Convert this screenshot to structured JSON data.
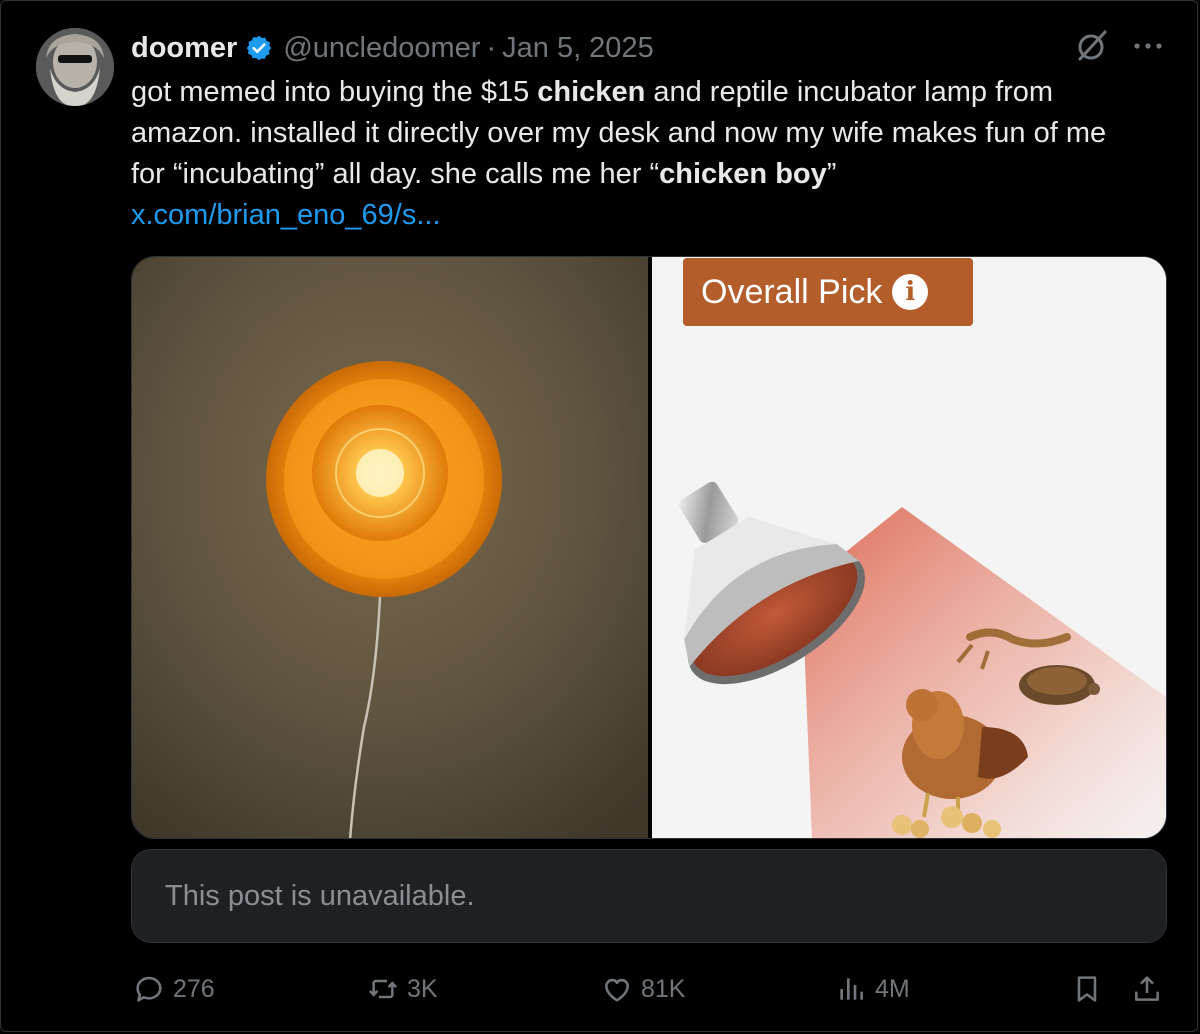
{
  "post": {
    "author_name": "doomer",
    "handle": "@uncledoomer",
    "separator": "·",
    "date": "Jan 5, 2025",
    "text_parts": [
      "got memed into buying the $15 ",
      "chicken",
      " and reptile incubator lamp from amazon. installed it directly over my desk and now my wife makes fun of me for “incubating” all day. she calls me her “",
      "chicken boy",
      "”"
    ],
    "link": "x.com/brian_eno_69/s..."
  },
  "media": {
    "badge_label": "Overall Pick",
    "badge_info_glyph": "i"
  },
  "quote": {
    "unavailable_text": "This post is unavailable."
  },
  "actions": {
    "replies": "276",
    "reposts": "3K",
    "likes": "81K",
    "views": "4M"
  },
  "icons": [
    "verified-badge-icon",
    "grok-icon",
    "more-icon",
    "reply-icon",
    "repost-icon",
    "like-icon",
    "views-icon",
    "bookmark-icon",
    "share-icon"
  ],
  "colors": {
    "background": "#000000",
    "text": "#e7e9ea",
    "muted": "#71767b",
    "link": "#1d9bf0",
    "badge": "#b35e2a"
  }
}
